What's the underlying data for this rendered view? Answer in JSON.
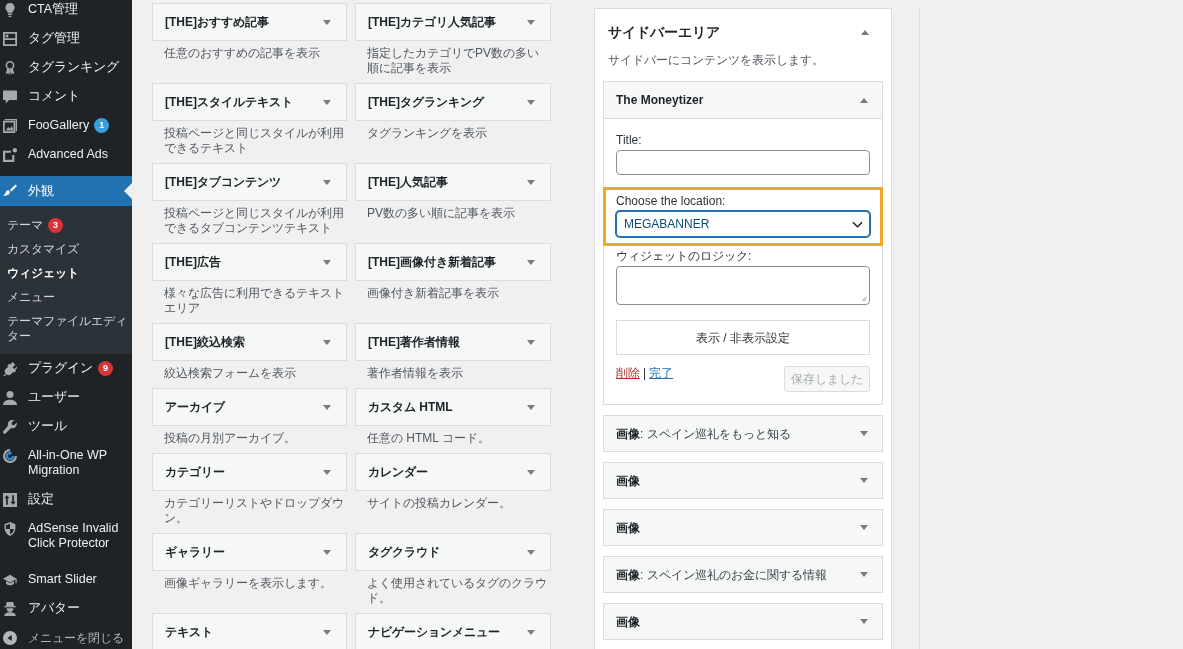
{
  "admin_menu": {
    "groups": [
      [
        {
          "label": "CTA管理",
          "selected": false
        },
        {
          "label": "タグ管理",
          "selected": false
        },
        {
          "label": "タグランキング",
          "selected": false
        },
        {
          "label": "コメント",
          "selected": false
        },
        {
          "label": "FooGallery",
          "selected": false,
          "badge": {
            "count": "1",
            "color": "#3b9ed8"
          }
        },
        {
          "label": "Advanced Ads",
          "selected": false
        }
      ],
      [
        {
          "label": "外観",
          "selected": true,
          "children": [
            {
              "label": "テーマ",
              "selected": false,
              "badge": {
                "count": "3",
                "color": "#d63638"
              }
            },
            {
              "label": "カスタマイズ",
              "selected": false
            },
            {
              "label": "ウィジェット",
              "selected": true
            },
            {
              "label": "メニュー",
              "selected": false
            },
            {
              "label": "テーマファイルエディター",
              "selected": false
            }
          ]
        },
        {
          "label": "プラグイン",
          "selected": false,
          "badge": {
            "count": "9",
            "color": "#d63638"
          }
        },
        {
          "label": "ユーザー",
          "selected": false
        },
        {
          "label": "ツール",
          "selected": false
        },
        {
          "label": "All-in-One WP Migration",
          "selected": false
        },
        {
          "label": "設定",
          "selected": false
        },
        {
          "label": "AdSense Invalid Click Protector",
          "selected": false
        }
      ],
      [
        {
          "label": "Smart Slider",
          "selected": false
        },
        {
          "label": "アバター",
          "selected": false
        }
      ]
    ],
    "collapse_button": "メニューを閉じる"
  },
  "available_widgets": [
    {
      "title": "[THE]おすすめ記事",
      "description": "任意のおすすめの記事を表示"
    },
    {
      "title": "[THE]カテゴリ人気記事",
      "description": "指定したカテゴリでPV数の多い順に記事を表示"
    },
    {
      "title": "[THE]スタイルテキスト",
      "description": "投稿ページと同じスタイルが利用できるテキスト"
    },
    {
      "title": "[THE]タグランキング",
      "description": "タグランキングを表示"
    },
    {
      "title": "[THE]タブコンテンツ",
      "description": "投稿ページと同じスタイルが利用できるタブコンテンツテキスト"
    },
    {
      "title": "[THE]人気記事",
      "description": "PV数の多い順に記事を表示"
    },
    {
      "title": "[THE]広告",
      "description": "様々な広告に利用できるテキストエリア"
    },
    {
      "title": "[THE]画像付き新着記事",
      "description": "画像付き新着記事を表示"
    },
    {
      "title": "[THE]絞込検索",
      "description": "絞込検索フォームを表示"
    },
    {
      "title": "[THE]著作者情報",
      "description": "著作者情報を表示"
    },
    {
      "title": "アーカイブ",
      "description": "投稿の月別アーカイブ。"
    },
    {
      "title": "カスタム HTML",
      "description": "任意の HTML コード。"
    },
    {
      "title": "カテゴリー",
      "description": "カテゴリーリストやドロップダウン。"
    },
    {
      "title": "カレンダー",
      "description": "サイトの投稿カレンダー。"
    },
    {
      "title": "ギャラリー",
      "description": "画像ギャラリーを表示します。"
    },
    {
      "title": "タグクラウド",
      "description": "よく使用されているタグのクラウド。"
    },
    {
      "title": "テキスト"
    },
    {
      "title": "ナビゲーションメニュー"
    }
  ],
  "sidebar_area": {
    "title": "サイドバーエリア",
    "expanded": true,
    "description": "サイドバーにコンテンツを表示します。",
    "widgets": [
      {
        "name": "The Moneytizer",
        "expanded": true,
        "form": {
          "fields": [
            {
              "kind": "text",
              "label": "Title:",
              "focused": false,
              "highlighted": false
            },
            {
              "kind": "select",
              "label": "Choose the location:",
              "value": "MEGABANNER",
              "focused": true,
              "highlighted": true
            },
            {
              "kind": "textarea",
              "label": "ウィジェットのロジック:",
              "focused": false,
              "highlighted": false
            }
          ],
          "visibility_button": "表示 / 非表示設定",
          "delete_link": "削除",
          "link_separator": "|",
          "done_link": "完了",
          "save_button": {
            "label": "保存しました",
            "disabled": true
          }
        }
      },
      {
        "name": "画像",
        "instance": ": スペイン巡礼をもっと知る",
        "expanded": false
      },
      {
        "name": "画像",
        "expanded": false
      },
      {
        "name": "画像",
        "expanded": false
      },
      {
        "name": "画像",
        "instance": ": スペイン巡礼のお金に関する情報",
        "expanded": false
      },
      {
        "name": "画像",
        "expanded": false
      }
    ]
  }
}
